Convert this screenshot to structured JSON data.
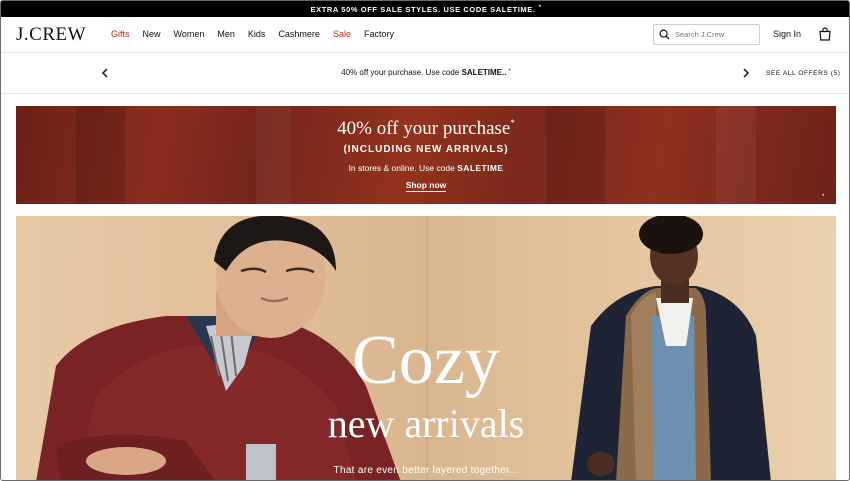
{
  "top_strip": {
    "text": "EXTRA 50% OFF SALE STYLES. USE CODE SALETIME.",
    "asterisk": "*"
  },
  "header": {
    "logo": "J.CREW",
    "nav": [
      {
        "label": "Gifts",
        "color": "#b32d1f"
      },
      {
        "label": "New"
      },
      {
        "label": "Women"
      },
      {
        "label": "Men"
      },
      {
        "label": "Kids"
      },
      {
        "label": "Cashmere"
      },
      {
        "label": "Sale",
        "color": "#b32d1f"
      },
      {
        "label": "Factory"
      }
    ],
    "search_placeholder": "Search J.Crew",
    "sign_in": "Sign In",
    "bag_icon": "shopping-bag-icon"
  },
  "offers": {
    "text_prefix": "40% off your purchase. Use code ",
    "code": "SALETIME..",
    "asterisk": "*",
    "see_all": "SEE ALL OFFERS (5)"
  },
  "promo": {
    "title": "40% off your purchase",
    "asterisk": "*",
    "subtitle": "(INCLUDING NEW ARRIVALS)",
    "line_prefix": "In stores & online. Use code ",
    "code": "SALETIME",
    "cta": "Shop now",
    "footnote": "*"
  },
  "hero": {
    "title": "Cozy",
    "subtitle": "new arrivals",
    "tagline": "That are even better layered together..."
  },
  "colors": {
    "accent_red": "#b32d1f",
    "promo_bg": "#7f2a1c",
    "hero_bg": "#e2c09b"
  }
}
